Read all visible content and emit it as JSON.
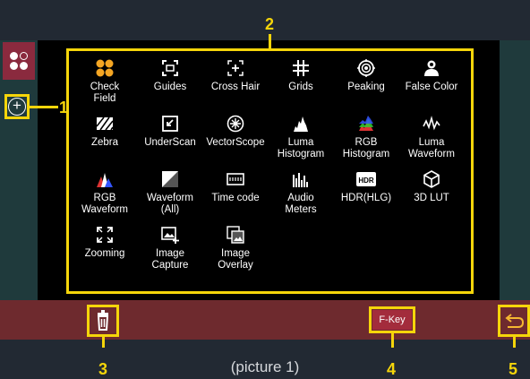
{
  "sidebar": {
    "logo_icon": "fourcircles-icon",
    "add_icon": "plus-circle-icon"
  },
  "panel": {
    "items": [
      {
        "label": "Check\nField",
        "icon": "check-field-icon"
      },
      {
        "label": "Guides",
        "icon": "guides-icon"
      },
      {
        "label": "Cross Hair",
        "icon": "cross-hair-icon"
      },
      {
        "label": "Grids",
        "icon": "grids-icon"
      },
      {
        "label": "Peaking",
        "icon": "peaking-icon"
      },
      {
        "label": "False Color",
        "icon": "false-color-icon"
      },
      {
        "label": "Zebra",
        "icon": "zebra-icon"
      },
      {
        "label": "UnderScan",
        "icon": "underscan-icon"
      },
      {
        "label": "VectorScope",
        "icon": "vectorscope-icon"
      },
      {
        "label": "Luma\nHistogram",
        "icon": "luma-histogram-icon"
      },
      {
        "label": "RGB\nHistogram",
        "icon": "rgb-histogram-icon"
      },
      {
        "label": "Luma\nWaveform",
        "icon": "luma-waveform-icon"
      },
      {
        "label": "RGB\nWaveform",
        "icon": "rgb-waveform-icon"
      },
      {
        "label": "Waveform\n(All)",
        "icon": "waveform-all-icon"
      },
      {
        "label": "Time code",
        "icon": "time-code-icon"
      },
      {
        "label": "Audio\nMeters",
        "icon": "audio-meters-icon"
      },
      {
        "label": "HDR(HLG)",
        "icon": "hdr-icon"
      },
      {
        "label": "3D LUT",
        "icon": "3d-lut-icon"
      },
      {
        "label": "Zooming",
        "icon": "zooming-icon"
      },
      {
        "label": "Image\nCapture",
        "icon": "image-capture-icon"
      },
      {
        "label": "Image\nOverlay",
        "icon": "image-overlay-icon"
      }
    ]
  },
  "bottom": {
    "delete_icon": "trash-icon",
    "fkey_label": "F-Key",
    "back_icon": "undo-arrow-icon"
  },
  "callouts": {
    "n1": "1",
    "n2": "2",
    "n3": "3",
    "n4": "4",
    "n5": "5"
  },
  "caption": "(picture 1)",
  "colors": {
    "callout": "#f5d50a",
    "bar": "#6e2a2e",
    "accent": "#a32c3c",
    "strip": "#1f3a3c"
  }
}
